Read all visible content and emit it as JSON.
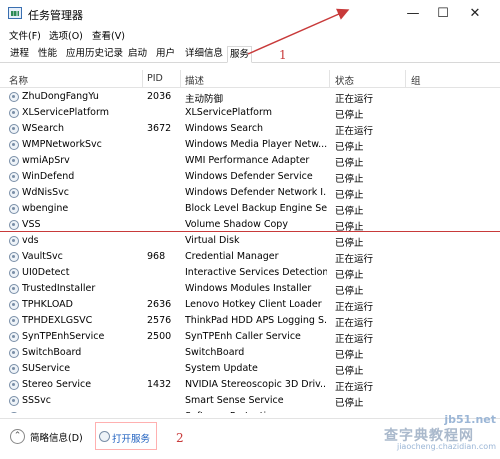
{
  "window": {
    "title": "任务管理器",
    "minimize": "—",
    "maximize": "☐",
    "close": "✕"
  },
  "menu": [
    {
      "label": "文件(F)"
    },
    {
      "label": "选项(O)"
    },
    {
      "label": "查看(V)"
    }
  ],
  "tabs": [
    {
      "label": "进程"
    },
    {
      "label": "性能"
    },
    {
      "label": "应用历史记录"
    },
    {
      "label": "启动"
    },
    {
      "label": "用户"
    },
    {
      "label": "详细信息"
    },
    {
      "label": "服务",
      "active": true
    }
  ],
  "columns": {
    "name": "名称",
    "pid": "PID",
    "desc": "描述",
    "status": "状态",
    "group": "组"
  },
  "services": [
    {
      "name": "ZhuDongFangYu",
      "pid": "2036",
      "desc": "主动防御",
      "status": "正在运行"
    },
    {
      "name": "XLServicePlatform",
      "pid": "",
      "desc": "XLServicePlatform",
      "status": "已停止"
    },
    {
      "name": "WSearch",
      "pid": "3672",
      "desc": "Windows Search",
      "status": "正在运行"
    },
    {
      "name": "WMPNetworkSvc",
      "pid": "",
      "desc": "Windows Media Player Netw...",
      "status": "已停止"
    },
    {
      "name": "wmiApSrv",
      "pid": "",
      "desc": "WMI Performance Adapter",
      "status": "已停止"
    },
    {
      "name": "WinDefend",
      "pid": "",
      "desc": "Windows Defender Service",
      "status": "已停止"
    },
    {
      "name": "WdNisSvc",
      "pid": "",
      "desc": "Windows Defender Network I...",
      "status": "已停止"
    },
    {
      "name": "wbengine",
      "pid": "",
      "desc": "Block Level Backup Engine Se...",
      "status": "已停止"
    },
    {
      "name": "VSS",
      "pid": "",
      "desc": "Volume Shadow Copy",
      "status": "已停止"
    },
    {
      "name": "vds",
      "pid": "",
      "desc": "Virtual Disk",
      "status": "已停止"
    },
    {
      "name": "VaultSvc",
      "pid": "968",
      "desc": "Credential Manager",
      "status": "正在运行"
    },
    {
      "name": "UI0Detect",
      "pid": "",
      "desc": "Interactive Services Detection",
      "status": "已停止"
    },
    {
      "name": "TrustedInstaller",
      "pid": "",
      "desc": "Windows Modules Installer",
      "status": "已停止"
    },
    {
      "name": "TPHKLOAD",
      "pid": "2636",
      "desc": "Lenovo Hotkey Client Loader",
      "status": "正在运行"
    },
    {
      "name": "TPHDEXLGSVC",
      "pid": "2576",
      "desc": "ThinkPad HDD APS Logging S...",
      "status": "正在运行"
    },
    {
      "name": "SynTPEnhService",
      "pid": "2500",
      "desc": "SynTPEnh Caller Service",
      "status": "正在运行"
    },
    {
      "name": "SwitchBoard",
      "pid": "",
      "desc": "SwitchBoard",
      "status": "已停止"
    },
    {
      "name": "SUService",
      "pid": "",
      "desc": "System Update",
      "status": "已停止"
    },
    {
      "name": "Stereo Service",
      "pid": "1432",
      "desc": "NVIDIA Stereoscopic 3D Driv...",
      "status": "正在运行"
    },
    {
      "name": "SSSvc",
      "pid": "",
      "desc": "Smart Sense Service",
      "status": "已停止"
    },
    {
      "name": "sppsvc",
      "pid": "",
      "desc": "Software Protection",
      "status": "已停止"
    }
  ],
  "footer": {
    "collapse_icon": "chevron-up-icon",
    "collapse_label": "简略信息(D)",
    "open_services_label": "打开服务"
  },
  "annotations": {
    "label_1": "1",
    "label_2": "2",
    "color": "#c83a3a"
  },
  "watermark": {
    "line1": "jb51.net",
    "line2": "查字典教程网",
    "line3": "jiaocheng.chazidian.com"
  }
}
